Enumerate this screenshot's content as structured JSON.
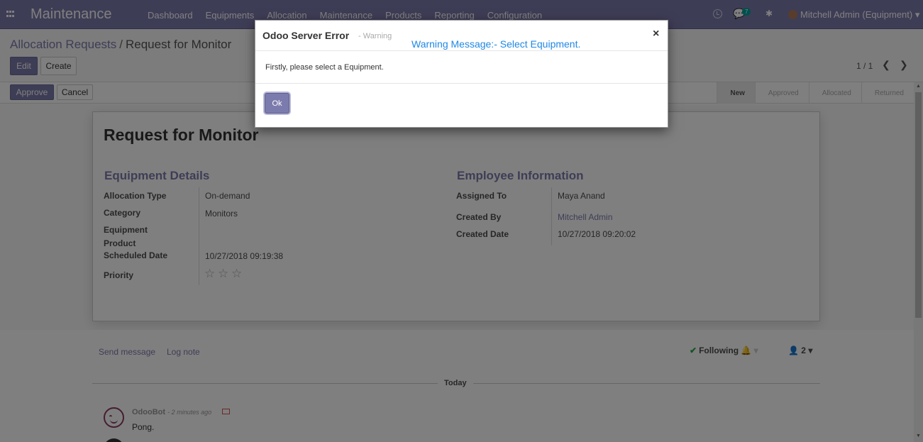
{
  "navbar": {
    "brand": "Maintenance",
    "menu": [
      "Dashboard",
      "Equipments",
      "Allocation",
      "Maintenance",
      "Products",
      "Reporting",
      "Configuration"
    ],
    "messages_count": "7",
    "user": "Mitchell Admin (Equipment)"
  },
  "breadcrumb": {
    "parent": "Allocation Requests",
    "separator": "/",
    "current": "Request for Monitor"
  },
  "buttons": {
    "edit": "Edit",
    "create": "Create",
    "approve": "Approve",
    "cancel": "Cancel"
  },
  "pager": {
    "value": "1 / 1"
  },
  "stages": [
    "New",
    "Approved",
    "Allocated",
    "Returned"
  ],
  "active_stage": "New",
  "form": {
    "title": "Request for Monitor",
    "equipment_section": "Equipment Details",
    "employee_section": "Employee Information",
    "left_fields": {
      "allocation_type_label": "Allocation Type",
      "allocation_type": "On-demand",
      "category_label": "Category",
      "category": "Monitors",
      "equipment_label": "Equipment",
      "product_label": "Product",
      "scheduled_date_label": "Scheduled Date",
      "scheduled_date": "10/27/2018 09:19:38",
      "priority_label": "Priority"
    },
    "right_fields": {
      "assigned_to_label": "Assigned To",
      "assigned_to": "Maya Anand",
      "created_by_label": "Created By",
      "created_by": "Mitchell Admin",
      "created_date_label": "Created Date",
      "created_date": "10/27/2018 09:20:02"
    },
    "priority_stars": 0
  },
  "chatter": {
    "send_message": "Send message",
    "log_note": "Log note",
    "following": "Following",
    "followers_count": "2",
    "date_separator": "Today",
    "message_author": "OdooBot",
    "message_time": "- 2 minutes ago",
    "message_body": "Pong."
  },
  "modal": {
    "title": "Odoo Server Error",
    "subtitle": "- Warning",
    "warning": "Warning Message:-  Select Equipment.",
    "body": "Firstly, please select a Equipment.",
    "ok": "Ok",
    "close": "×"
  },
  "colors": {
    "brand": "#7c7bad",
    "warning_text": "#1e88e5"
  }
}
